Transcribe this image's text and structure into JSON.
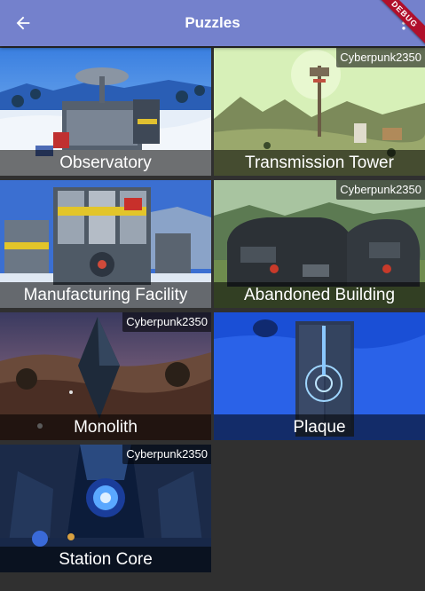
{
  "appbar": {
    "title": "Puzzles",
    "back_icon": "arrow-back-icon",
    "menu_icon": "overflow-menu-icon",
    "color": "#7481cc"
  },
  "debug_banner": {
    "label": "DEBUG",
    "color": "#b0102b"
  },
  "tiles": [
    {
      "label": "Observatory",
      "author": ""
    },
    {
      "label": "Transmission Tower",
      "author": "Cyberpunk2350"
    },
    {
      "label": "Manufacturing Facility",
      "author": ""
    },
    {
      "label": "Abandoned Building",
      "author": "Cyberpunk2350"
    },
    {
      "label": "Monolith",
      "author": "Cyberpunk2350"
    },
    {
      "label": "Plaque",
      "author": ""
    },
    {
      "label": "Station Core",
      "author": "Cyberpunk2350"
    }
  ]
}
